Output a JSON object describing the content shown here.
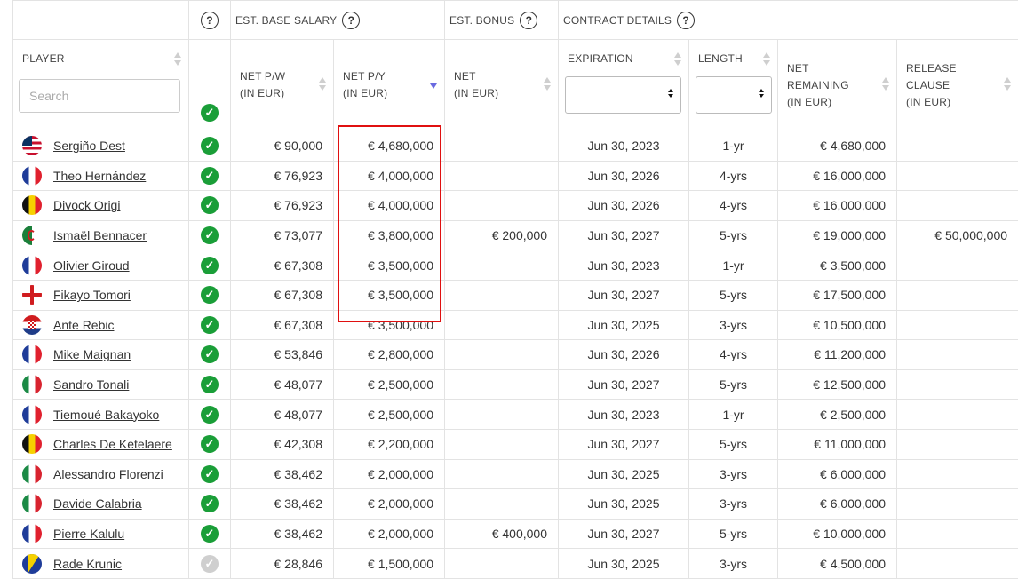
{
  "groups": {
    "base_salary": "EST. BASE SALARY",
    "bonus": "EST. BONUS",
    "contract": "CONTRACT DETAILS",
    "help": "?"
  },
  "columns": {
    "player": "PLAYER",
    "net_pw": [
      "NET P/W",
      "(IN EUR)"
    ],
    "net_py": [
      "NET P/Y",
      "(IN EUR)"
    ],
    "bonus_net": [
      "NET",
      "(IN EUR)"
    ],
    "expiration": "EXPIRATION",
    "length": "LENGTH",
    "net_remaining": [
      "NET",
      "REMAINING",
      "(IN EUR)"
    ],
    "release_clause": [
      "RELEASE",
      "CLAUSE",
      "(IN EUR)"
    ]
  },
  "search": {
    "placeholder": "Search"
  },
  "sort": {
    "column": "net_py",
    "direction": "descending"
  },
  "highlight": {
    "column": "net_py",
    "rows": [
      0,
      6
    ],
    "color": "#e01010"
  },
  "colors": {
    "check": "#1a9e38",
    "check_inactive": "#cfcfcf",
    "sort_active": "#6a6ae0"
  },
  "rows": [
    {
      "flag": "usa",
      "player": "Sergiño Dest",
      "active": true,
      "net_pw": "€ 90,000",
      "net_py": "€ 4,680,000",
      "bonus": "",
      "expiration": "Jun 30, 2023",
      "length": "1-yr",
      "net_remaining": "€ 4,680,000",
      "release": ""
    },
    {
      "flag": "france",
      "player": "Theo Hernández",
      "active": true,
      "net_pw": "€ 76,923",
      "net_py": "€ 4,000,000",
      "bonus": "",
      "expiration": "Jun 30, 2026",
      "length": "4-yrs",
      "net_remaining": "€ 16,000,000",
      "release": ""
    },
    {
      "flag": "belgium",
      "player": "Divock Origi",
      "active": true,
      "net_pw": "€ 76,923",
      "net_py": "€ 4,000,000",
      "bonus": "",
      "expiration": "Jun 30, 2026",
      "length": "4-yrs",
      "net_remaining": "€ 16,000,000",
      "release": ""
    },
    {
      "flag": "algeria",
      "player": "Ismaël Bennacer",
      "active": true,
      "net_pw": "€ 73,077",
      "net_py": "€ 3,800,000",
      "bonus": "€ 200,000",
      "expiration": "Jun 30, 2027",
      "length": "5-yrs",
      "net_remaining": "€ 19,000,000",
      "release": "€ 50,000,000"
    },
    {
      "flag": "france",
      "player": "Olivier Giroud",
      "active": true,
      "net_pw": "€ 67,308",
      "net_py": "€ 3,500,000",
      "bonus": "",
      "expiration": "Jun 30, 2023",
      "length": "1-yr",
      "net_remaining": "€ 3,500,000",
      "release": ""
    },
    {
      "flag": "england",
      "player": "Fikayo Tomori",
      "active": true,
      "net_pw": "€ 67,308",
      "net_py": "€ 3,500,000",
      "bonus": "",
      "expiration": "Jun 30, 2027",
      "length": "5-yrs",
      "net_remaining": "€ 17,500,000",
      "release": ""
    },
    {
      "flag": "croatia",
      "player": "Ante Rebic",
      "active": true,
      "net_pw": "€ 67,308",
      "net_py": "€ 3,500,000",
      "bonus": "",
      "expiration": "Jun 30, 2025",
      "length": "3-yrs",
      "net_remaining": "€ 10,500,000",
      "release": ""
    },
    {
      "flag": "france",
      "player": "Mike Maignan",
      "active": true,
      "net_pw": "€ 53,846",
      "net_py": "€ 2,800,000",
      "bonus": "",
      "expiration": "Jun 30, 2026",
      "length": "4-yrs",
      "net_remaining": "€ 11,200,000",
      "release": ""
    },
    {
      "flag": "italy",
      "player": "Sandro Tonali",
      "active": true,
      "net_pw": "€ 48,077",
      "net_py": "€ 2,500,000",
      "bonus": "",
      "expiration": "Jun 30, 2027",
      "length": "5-yrs",
      "net_remaining": "€ 12,500,000",
      "release": ""
    },
    {
      "flag": "france",
      "player": "Tiemoué Bakayoko",
      "active": true,
      "net_pw": "€ 48,077",
      "net_py": "€ 2,500,000",
      "bonus": "",
      "expiration": "Jun 30, 2023",
      "length": "1-yr",
      "net_remaining": "€ 2,500,000",
      "release": ""
    },
    {
      "flag": "belgium",
      "player": "Charles De Ketelaere",
      "active": true,
      "net_pw": "€ 42,308",
      "net_py": "€ 2,200,000",
      "bonus": "",
      "expiration": "Jun 30, 2027",
      "length": "5-yrs",
      "net_remaining": "€ 11,000,000",
      "release": ""
    },
    {
      "flag": "italy",
      "player": "Alessandro Florenzi",
      "active": true,
      "net_pw": "€ 38,462",
      "net_py": "€ 2,000,000",
      "bonus": "",
      "expiration": "Jun 30, 2025",
      "length": "3-yrs",
      "net_remaining": "€ 6,000,000",
      "release": ""
    },
    {
      "flag": "italy",
      "player": "Davide Calabria",
      "active": true,
      "net_pw": "€ 38,462",
      "net_py": "€ 2,000,000",
      "bonus": "",
      "expiration": "Jun 30, 2025",
      "length": "3-yrs",
      "net_remaining": "€ 6,000,000",
      "release": ""
    },
    {
      "flag": "france",
      "player": "Pierre Kalulu",
      "active": true,
      "net_pw": "€ 38,462",
      "net_py": "€ 2,000,000",
      "bonus": "€ 400,000",
      "expiration": "Jun 30, 2027",
      "length": "5-yrs",
      "net_remaining": "€ 10,000,000",
      "release": ""
    },
    {
      "flag": "bosnia",
      "player": "Rade Krunic",
      "active": false,
      "net_pw": "€ 28,846",
      "net_py": "€ 1,500,000",
      "bonus": "",
      "expiration": "Jun 30, 2025",
      "length": "3-yrs",
      "net_remaining": "€ 4,500,000",
      "release": ""
    }
  ]
}
